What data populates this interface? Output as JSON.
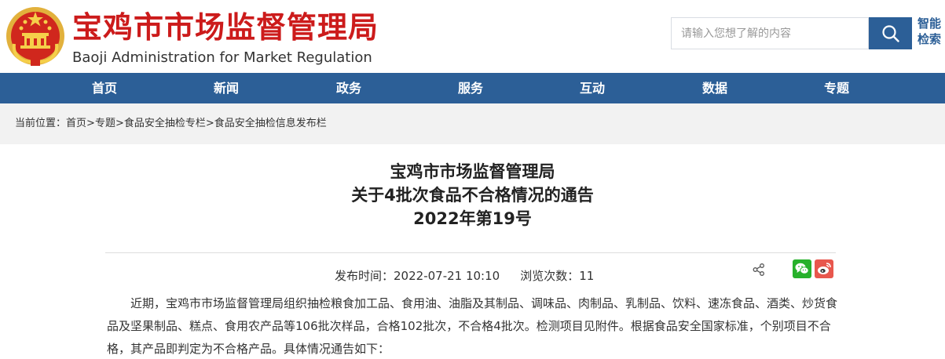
{
  "header": {
    "title": "宝鸡市市场监督管理局",
    "subtitle": "Baoji Administration for Market Regulation",
    "emblem_icon": "national-emblem-icon",
    "search": {
      "placeholder": "请输入您想了解的内容",
      "value": "",
      "button_icon": "search-icon"
    },
    "smart_search_label": "智能检索"
  },
  "nav": {
    "items": [
      {
        "label": "首页"
      },
      {
        "label": "新闻"
      },
      {
        "label": "政务"
      },
      {
        "label": "服务"
      },
      {
        "label": "互动"
      },
      {
        "label": "数据"
      },
      {
        "label": "专题"
      }
    ]
  },
  "breadcrumb": {
    "prefix": "当前位置：",
    "items": [
      {
        "label": "首页"
      },
      {
        "label": "专题"
      },
      {
        "label": "食品安全抽检专栏"
      },
      {
        "label": "食品安全抽检信息发布栏"
      }
    ],
    "separator": ">"
  },
  "article": {
    "title_lines": [
      "宝鸡市市场监督管理局",
      "关于4批次食品不合格情况的通告",
      "2022年第19号"
    ],
    "publish_label": "发布时间：",
    "publish_time": "2022-07-21 10:10",
    "views_label": "浏览次数：",
    "views": "11",
    "share_icons": [
      "share-icon",
      "wechat-icon",
      "weibo-icon"
    ],
    "body": "近期，宝鸡市市场监督管理局组织抽检粮食加工品、食用油、油脂及其制品、调味品、肉制品、乳制品、饮料、速冻食品、酒类、炒货食品及坚果制品、糕点、食用农产品等106批次样品，合格102批次，不合格4批次。检测项目见附件。根据食品安全国家标准，个别项目不合格，其产品即判定为不合格产品。具体情况通告如下："
  },
  "colors": {
    "brand_red": "#cc1b1b",
    "nav_blue": "#2c5f97",
    "wechat_green": "#27b12b",
    "weibo_red": "#e8574d"
  }
}
